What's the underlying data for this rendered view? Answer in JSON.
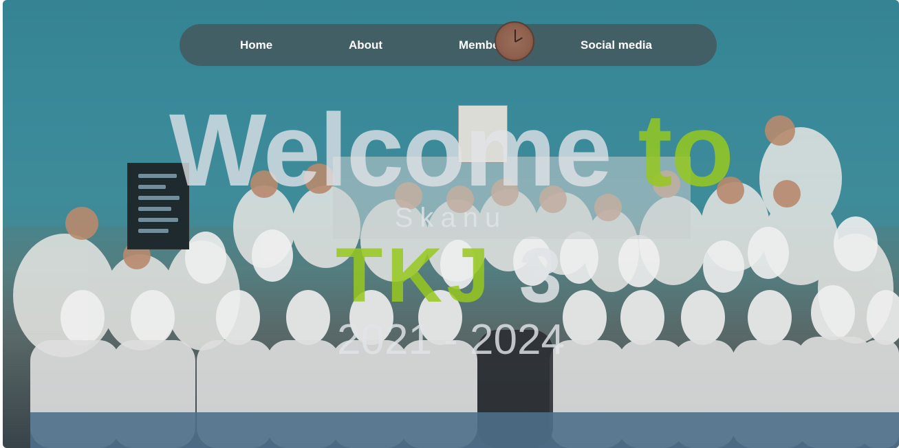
{
  "nav": {
    "items": [
      {
        "label": "Home"
      },
      {
        "label": "About"
      },
      {
        "label": "Member"
      },
      {
        "label": "Social media"
      }
    ]
  },
  "hero": {
    "welcome_part1": "Welcome",
    "welcome_part2": "to",
    "subtitle": "Skanu",
    "class_part1": "TKJ",
    "class_part2": "3",
    "years": "2021 - 2024"
  },
  "colors": {
    "accent_green": "#96c81e",
    "text_light": "#e1e4e8",
    "nav_bg": "#465055"
  }
}
